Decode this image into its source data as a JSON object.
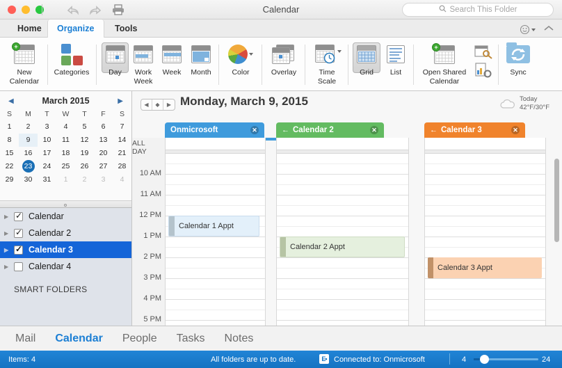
{
  "window": {
    "title": "Calendar",
    "traffic_lights": [
      "close",
      "minimize",
      "zoom"
    ],
    "undo_icon": "undo-icon",
    "redo_icon": "redo-icon",
    "print_icon": "print-icon"
  },
  "search": {
    "placeholder": "Search This Folder",
    "icon": "search-icon"
  },
  "ribbon_tabs": [
    {
      "label": "Home",
      "active": false
    },
    {
      "label": "Organize",
      "active": true
    },
    {
      "label": "Tools",
      "active": false
    }
  ],
  "ribbon_right": {
    "emoji_icon": "smiley-icon",
    "collapse_icon": "chevron-up-icon"
  },
  "ribbon": {
    "items": [
      {
        "label": "New\nCalendar",
        "name": "new-calendar",
        "icon": "new-calendar-icon"
      },
      {
        "label": "Categories",
        "name": "categories",
        "icon": "categories-icon"
      },
      {
        "label": "Day",
        "name": "day-view",
        "icon": "day-view-icon",
        "selected": true
      },
      {
        "label": "Work\nWeek",
        "name": "work-week-view",
        "icon": "work-week-icon"
      },
      {
        "label": "Week",
        "name": "week-view",
        "icon": "week-view-icon"
      },
      {
        "label": "Month",
        "name": "month-view",
        "icon": "month-view-icon"
      },
      {
        "label": "Color",
        "name": "color",
        "icon": "color-wheel-icon"
      },
      {
        "label": "Overlay",
        "name": "overlay",
        "icon": "overlay-icon"
      },
      {
        "label": "Time\nScale",
        "name": "time-scale",
        "icon": "time-scale-icon"
      },
      {
        "label": "Grid",
        "name": "grid-view",
        "icon": "grid-icon",
        "selected": true
      },
      {
        "label": "List",
        "name": "list-view",
        "icon": "list-icon"
      },
      {
        "label": "Open Shared\nCalendar",
        "name": "open-shared-calendar",
        "icon": "shared-calendar-icon"
      },
      {
        "label": "Sync",
        "name": "sync",
        "icon": "sync-icon"
      }
    ],
    "labels": {
      "new_calendar_l1": "New",
      "new_calendar_l2": "Calendar",
      "categories": "Categories",
      "day": "Day",
      "work_week_l1": "Work",
      "work_week_l2": "Week",
      "week": "Week",
      "month": "Month",
      "color": "Color",
      "overlay": "Overlay",
      "time_scale_l1": "Time",
      "time_scale_l2": "Scale",
      "grid": "Grid",
      "list": "List",
      "open_shared_l1": "Open Shared",
      "open_shared_l2": "Calendar",
      "sync": "Sync"
    }
  },
  "mini_calendar": {
    "title": "March 2015",
    "prev_icon": "chevron-left-icon",
    "next_icon": "chevron-right-icon",
    "day_headers": [
      "S",
      "M",
      "T",
      "W",
      "T",
      "F",
      "S"
    ],
    "weeks": [
      [
        {
          "d": "1"
        },
        {
          "d": "2"
        },
        {
          "d": "3"
        },
        {
          "d": "4"
        },
        {
          "d": "5"
        },
        {
          "d": "6"
        },
        {
          "d": "7"
        }
      ],
      [
        {
          "d": "8"
        },
        {
          "d": "9",
          "state": "highlight"
        },
        {
          "d": "10"
        },
        {
          "d": "11"
        },
        {
          "d": "12"
        },
        {
          "d": "13"
        },
        {
          "d": "14"
        }
      ],
      [
        {
          "d": "15"
        },
        {
          "d": "16"
        },
        {
          "d": "17"
        },
        {
          "d": "18"
        },
        {
          "d": "19"
        },
        {
          "d": "20"
        },
        {
          "d": "21"
        }
      ],
      [
        {
          "d": "22"
        },
        {
          "d": "23",
          "state": "today"
        },
        {
          "d": "24"
        },
        {
          "d": "25"
        },
        {
          "d": "26"
        },
        {
          "d": "27"
        },
        {
          "d": "28"
        }
      ],
      [
        {
          "d": "29"
        },
        {
          "d": "30"
        },
        {
          "d": "31"
        },
        {
          "d": "1",
          "state": "out"
        },
        {
          "d": "2",
          "state": "out"
        },
        {
          "d": "3",
          "state": "out"
        },
        {
          "d": "4",
          "state": "out"
        }
      ]
    ]
  },
  "calendar_list": {
    "items": [
      {
        "label": "Calendar",
        "checked": true,
        "selected": false
      },
      {
        "label": "Calendar 2",
        "checked": true,
        "selected": false
      },
      {
        "label": "Calendar 3",
        "checked": true,
        "selected": true
      },
      {
        "label": "Calendar 4",
        "checked": false,
        "selected": false
      }
    ],
    "smart_folders_label": "SMART FOLDERS"
  },
  "day_header": {
    "title": "Monday, March 9, 2015",
    "nav": {
      "prev_icon": "triangle-left-icon",
      "today_icon": "diamond-icon",
      "next_icon": "triangle-right-icon"
    },
    "weather": {
      "icon": "cloud-icon",
      "day": "Today",
      "temps": "42°F/30°F"
    }
  },
  "calendar_columns": [
    {
      "name": "Onmicrosoft",
      "color": "#3f9bdc",
      "has_back_arrow": false,
      "close_icon": "close-icon",
      "appointment": {
        "title": "Calendar 1 Appt",
        "bg": "#e3f0fa",
        "bar": "#b4c3cc",
        "start": "12 PM",
        "end": "1 PM"
      }
    },
    {
      "name": "Calendar 2",
      "color": "#63bb61",
      "has_back_arrow": true,
      "close_icon": "close-icon",
      "back_icon": "arrow-left-icon",
      "appointment": {
        "title": "Calendar 2 Appt",
        "bg": "#e5f0de",
        "bar": "#b6c4a4",
        "start": "1 PM",
        "end": "2 PM"
      }
    },
    {
      "name": "Calendar 3",
      "color": "#f0832c",
      "has_back_arrow": true,
      "close_icon": "close-icon",
      "back_icon": "arrow-left-icon",
      "appointment": {
        "title": "Calendar 3 Appt",
        "bg": "#fbd2b2",
        "bar": "#c19168",
        "start": "2 PM",
        "end": "3 PM"
      }
    }
  ],
  "time_grid": {
    "all_day_label": "ALL DAY",
    "hours": [
      "10 AM",
      "11 AM",
      "12 PM",
      "1 PM",
      "2 PM",
      "3 PM",
      "4 PM",
      "5 PM"
    ]
  },
  "bottom_nav": [
    {
      "label": "Mail",
      "active": false
    },
    {
      "label": "Calendar",
      "active": true
    },
    {
      "label": "People",
      "active": false
    },
    {
      "label": "Tasks",
      "active": false
    },
    {
      "label": "Notes",
      "active": false
    }
  ],
  "status_bar": {
    "items": "Items: 4",
    "sync_status": "All folders are up to date.",
    "exchange_icon": "exchange-icon",
    "connection": "Connected to: Onmicrosoft",
    "zoom_min": "4",
    "zoom_max": "24"
  },
  "colors": {
    "accent": "#1c7fd4",
    "status_bar": "#1573c2",
    "selection": "#1565d8",
    "today": "#1a6fb5"
  }
}
